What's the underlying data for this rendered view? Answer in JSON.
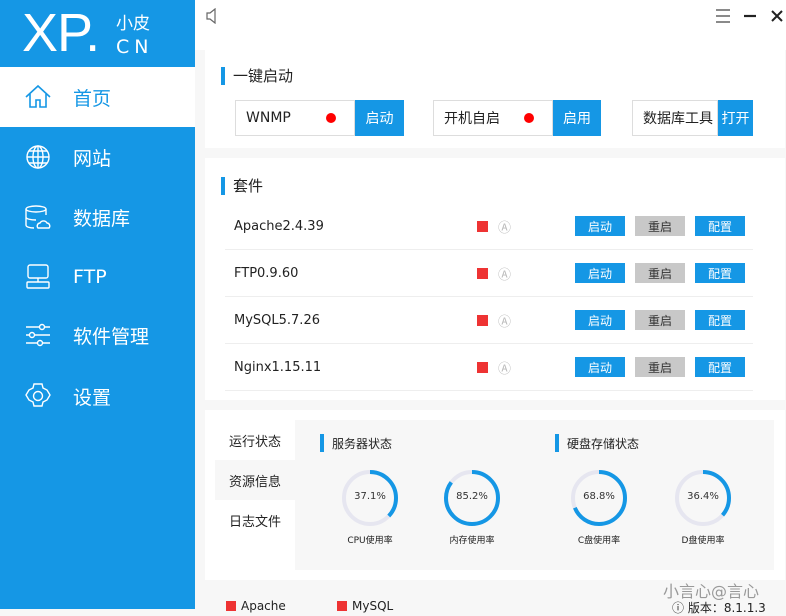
{
  "logo": {
    "main": "XP",
    "dot": ".",
    "cn_top": "小皮",
    "cn_bottom": "CN"
  },
  "sidebar": {
    "items": [
      {
        "label": "首页",
        "icon": "home-icon",
        "active": true
      },
      {
        "label": "网站",
        "icon": "globe-icon"
      },
      {
        "label": "数据库",
        "icon": "database-icon"
      },
      {
        "label": "FTP",
        "icon": "ftp-icon"
      },
      {
        "label": "软件管理",
        "icon": "sliders-icon"
      },
      {
        "label": "设置",
        "icon": "gear-icon"
      }
    ]
  },
  "titlebar": {
    "icons": [
      "speaker-icon",
      "menu-icon",
      "minimize-icon",
      "close-icon"
    ]
  },
  "quick": {
    "title": "一键启动",
    "items": [
      {
        "label": "WNMP",
        "button": "启动",
        "status_color": "#ff0000"
      },
      {
        "label": "开机自启",
        "button": "启用",
        "status_color": "#ff0000"
      },
      {
        "label": "数据库工具",
        "button": "打开"
      }
    ]
  },
  "suite": {
    "title": "套件",
    "status_glyph": "Ⓐ",
    "buttons": [
      "启动",
      "重启",
      "配置"
    ],
    "rows": [
      {
        "name": "Apache2.4.39"
      },
      {
        "name": "FTP0.9.60"
      },
      {
        "name": "MySQL5.7.26"
      },
      {
        "name": "Nginx1.15.11"
      }
    ]
  },
  "tabs": [
    {
      "label": "运行状态"
    },
    {
      "label": "资源信息",
      "active": true
    },
    {
      "label": "日志文件"
    }
  ],
  "status": {
    "server_title": "服务器状态",
    "disk_title": "硬盘存储状态",
    "gauges": [
      {
        "label": "CPU使用率",
        "value": 37.1,
        "text": "37.1%"
      },
      {
        "label": "内存使用率",
        "value": 85.2,
        "text": "85.2%"
      },
      {
        "label": "C盘使用率",
        "value": 68.8,
        "text": "68.8%"
      },
      {
        "label": "D盘使用率",
        "value": 36.4,
        "text": "36.4%"
      }
    ]
  },
  "footer": {
    "items": [
      "Apache",
      "MySQL"
    ],
    "version": "版本：8.1.1.3",
    "watermark": "小言心@言心"
  },
  "colors": {
    "accent": "#1597e5",
    "stopped": "#e33333",
    "track": "#e6e6f0"
  }
}
